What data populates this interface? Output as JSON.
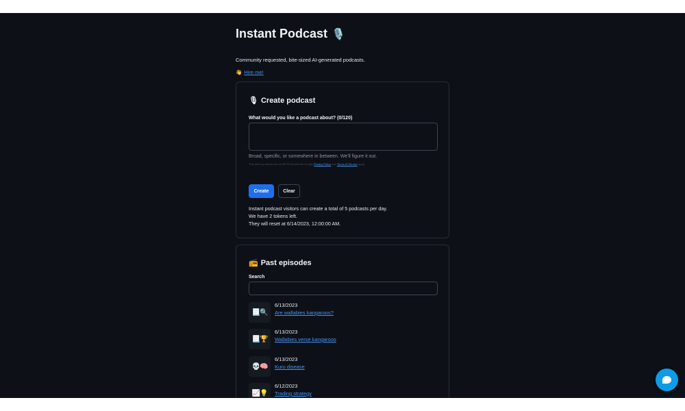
{
  "header": {
    "title": "Instant Podcast",
    "title_icon": "🎙️",
    "subtitle": "Community requested, bite-sized AI-generated podcasts.",
    "hire_icon": "👋",
    "hire_label": "Hire me!"
  },
  "create": {
    "heading_icon": "🎙",
    "heading": "Create podcast",
    "field_label": "What would you like a podcast about? (0/120)",
    "field_value": "",
    "hint": "Broad, specific, or somewhere in between. We'll figure it out.",
    "legal_prefix": "This site is protected by reCAPTCHA and the Google",
    "privacy_label": "Privacy Policy",
    "legal_and": "and",
    "terms_label": "Terms of Service",
    "legal_suffix": "apply.",
    "create_label": "Create",
    "clear_label": "Clear",
    "info_line1": "Instant podcast visitors can create a total of 5 podcasts per day.",
    "info_line2": "We have 2 tokens left.",
    "info_line3": "They will reset at 6/14/2023, 12:00:00 AM."
  },
  "episodes": {
    "heading_icon": "📻",
    "heading": "Past episodes",
    "search_label": "Search",
    "search_value": "",
    "items": [
      {
        "icons": "📃🔍",
        "date": "6/13/2023",
        "title": "Are wallabies kangaroos?"
      },
      {
        "icons": "📃🏆",
        "date": "6/13/2023",
        "title": "Wallabies verse kangaroos"
      },
      {
        "icons": "💀🧠",
        "date": "6/13/2023",
        "title": "Kuru disease"
      },
      {
        "icons": "📈💡",
        "date": "6/12/2023",
        "title": "Trading strategy"
      }
    ]
  },
  "colors": {
    "background": "#0d1117",
    "accent": "#1f6feb",
    "link": "#4493f8",
    "chat": "#0e9be8"
  }
}
